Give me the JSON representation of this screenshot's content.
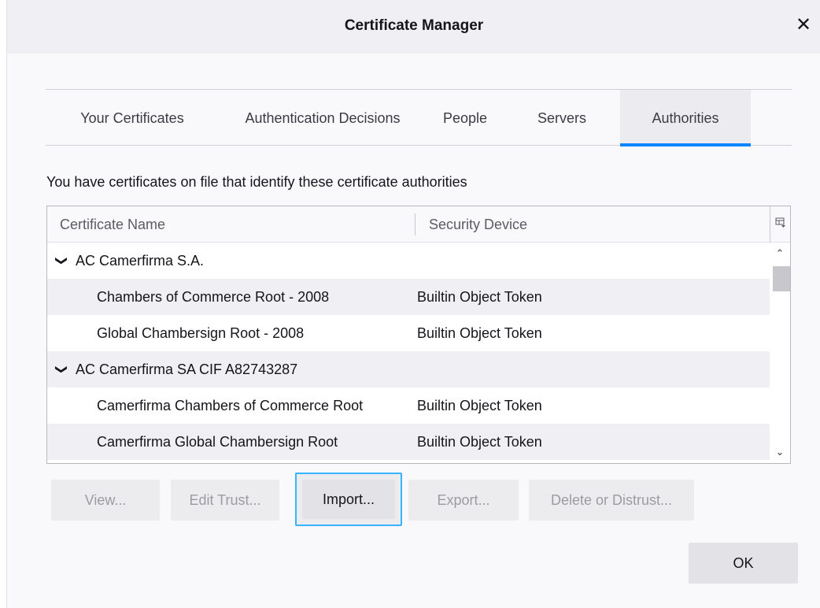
{
  "dialog": {
    "title": "Certificate Manager",
    "close_glyph": "✕"
  },
  "tabs": [
    {
      "label": "Your Certificates",
      "active": false
    },
    {
      "label": "Authentication Decisions",
      "active": false
    },
    {
      "label": "People",
      "active": false
    },
    {
      "label": "Servers",
      "active": false
    },
    {
      "label": "Authorities",
      "active": true
    }
  ],
  "description": "You have certificates on file that identify these certificate authorities",
  "tree": {
    "columns": [
      "Certificate Name",
      "Security Device"
    ],
    "column_picker_icon": "column-picker-icon",
    "rows": [
      {
        "name": "AC Camerfirma S.A.",
        "device": "",
        "type": "parent"
      },
      {
        "name": "Chambers of Commerce Root - 2008",
        "device": "Builtin Object Token",
        "type": "child"
      },
      {
        "name": "Global Chambersign Root - 2008",
        "device": "Builtin Object Token",
        "type": "child"
      },
      {
        "name": "AC Camerfirma SA CIF A82743287",
        "device": "",
        "type": "parent"
      },
      {
        "name": "Camerfirma Chambers of Commerce Root",
        "device": "Builtin Object Token",
        "type": "child"
      },
      {
        "name": "Camerfirma Global Chambersign Root",
        "device": "Builtin Object Token",
        "type": "child"
      }
    ]
  },
  "buttons": {
    "view": "View...",
    "edit_trust": "Edit Trust...",
    "import": "Import...",
    "export": "Export...",
    "delete_or_distrust": "Delete or Distrust...",
    "ok": "OK"
  },
  "colors": {
    "accent": "#0a84ff",
    "focus_ring": "#36b4ff"
  }
}
